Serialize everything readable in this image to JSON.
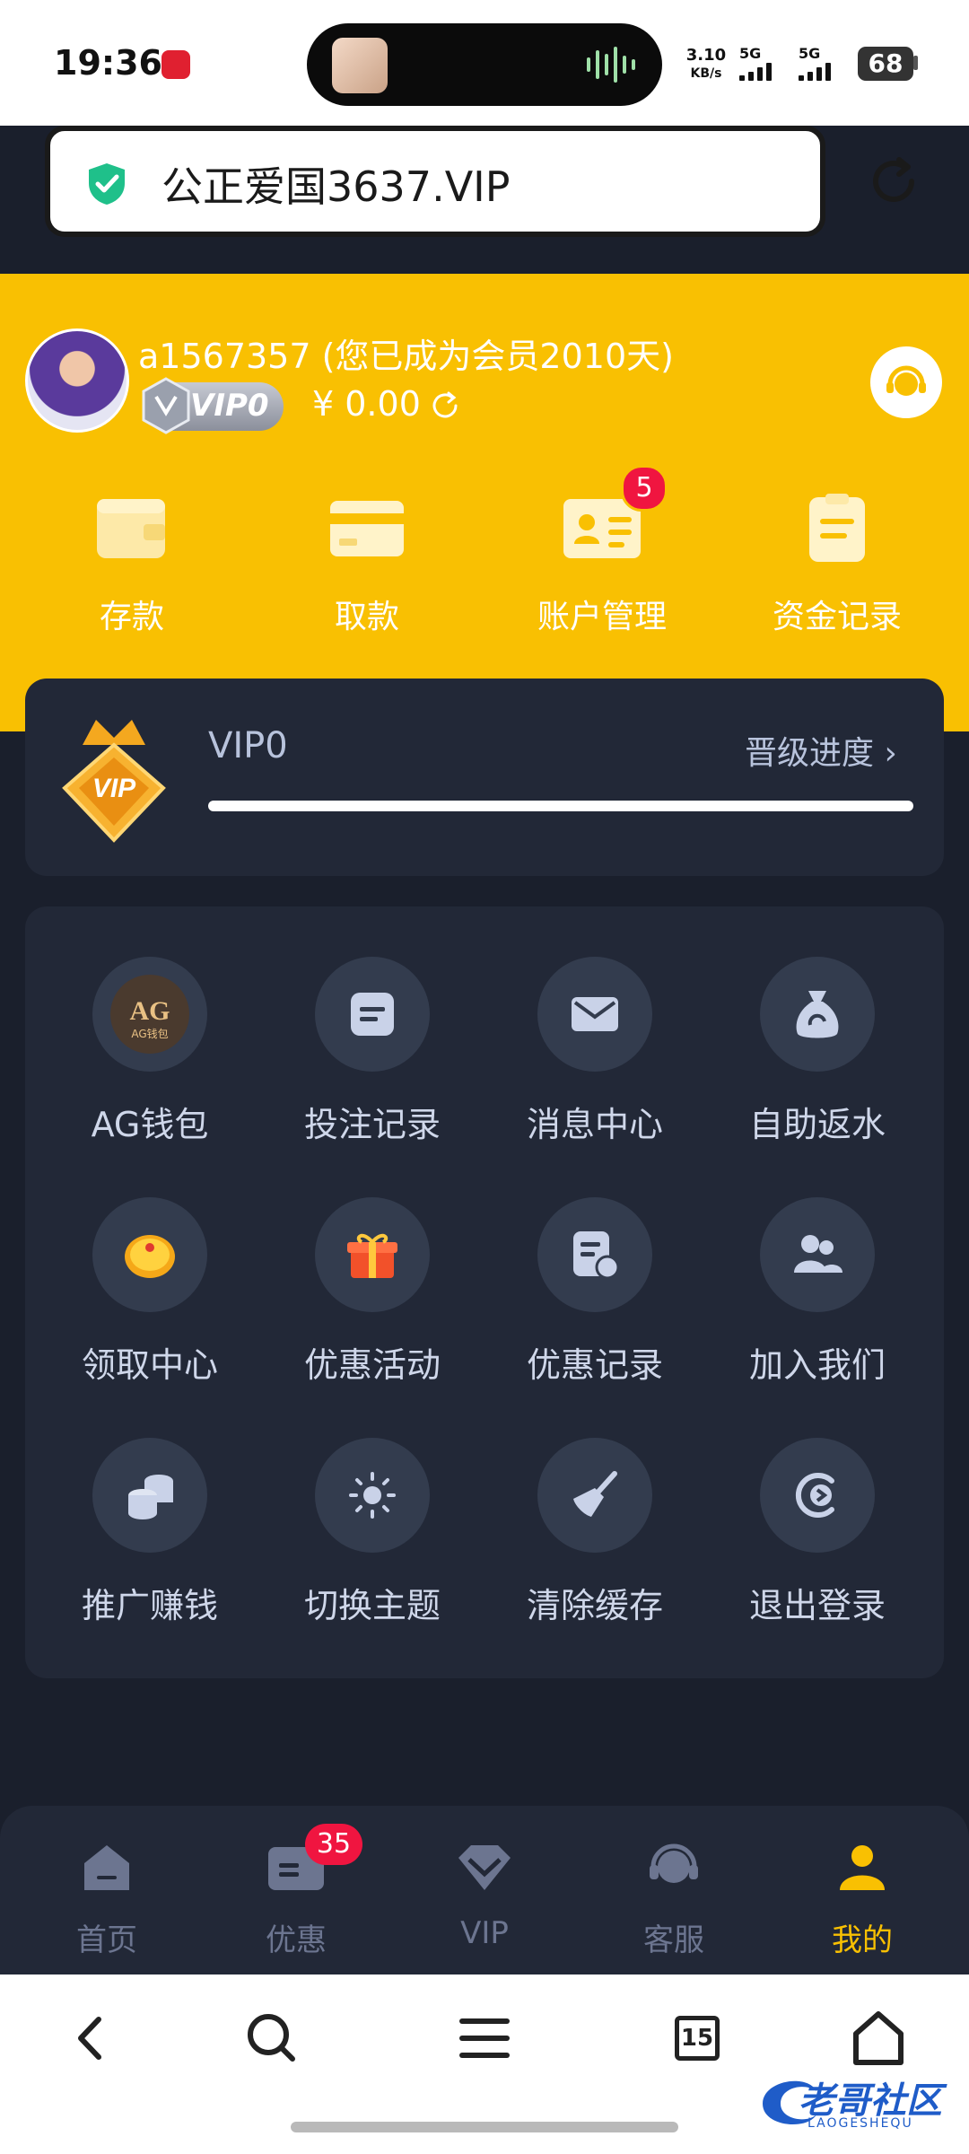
{
  "status_bar": {
    "time": "19:36",
    "net_speed": "3.10",
    "net_unit": "KB/s",
    "signal1_label": "5G",
    "signal2_label": "5G",
    "battery": "68"
  },
  "browser": {
    "url": "公正爱国3637.VIP"
  },
  "profile": {
    "username": "a1567357 (您已成为会员2010天)",
    "vip_badge": "VIP0",
    "balance": "¥ 0.00"
  },
  "quick_actions": [
    {
      "label": "存款",
      "icon": "wallet-icon"
    },
    {
      "label": "取款",
      "icon": "card-icon"
    },
    {
      "label": "账户管理",
      "icon": "id-card-icon",
      "badge": "5"
    },
    {
      "label": "资金记录",
      "icon": "clipboard-icon"
    }
  ],
  "vip_card": {
    "level": "VIP0",
    "progress_link": "晋级进度",
    "progress": 0
  },
  "grid": [
    {
      "label": "AG钱包",
      "icon": "ag-wallet-icon",
      "icon_text": "AG",
      "icon_subtext": "AG钱包"
    },
    {
      "label": "投注记录",
      "icon": "bet-record-icon"
    },
    {
      "label": "消息中心",
      "icon": "envelope-icon"
    },
    {
      "label": "自助返水",
      "icon": "money-bag-icon"
    },
    {
      "label": "领取中心",
      "icon": "gold-coin-icon"
    },
    {
      "label": "优惠活动",
      "icon": "gift-icon"
    },
    {
      "label": "优惠记录",
      "icon": "promo-record-icon"
    },
    {
      "label": "加入我们",
      "icon": "users-icon"
    },
    {
      "label": "推广赚钱",
      "icon": "coins-icon"
    },
    {
      "label": "切换主题",
      "icon": "sun-icon"
    },
    {
      "label": "清除缓存",
      "icon": "broom-icon"
    },
    {
      "label": "退出登录",
      "icon": "logout-icon"
    }
  ],
  "bottom_nav": [
    {
      "label": "首页",
      "icon": "home-icon"
    },
    {
      "label": "优惠",
      "icon": "ticket-icon",
      "badge": "35"
    },
    {
      "label": "VIP",
      "icon": "diamond-icon"
    },
    {
      "label": "客服",
      "icon": "headset-icon"
    },
    {
      "label": "我的",
      "icon": "user-icon",
      "active": true
    }
  ],
  "browser_bar": {
    "tab_count": "15"
  },
  "watermark": {
    "text": "老哥社区",
    "sub": "LAOGESHEQU"
  },
  "colors": {
    "accent": "#f9c002",
    "background": "#1a1f2c",
    "card": "#222837",
    "badge": "#f01540"
  }
}
